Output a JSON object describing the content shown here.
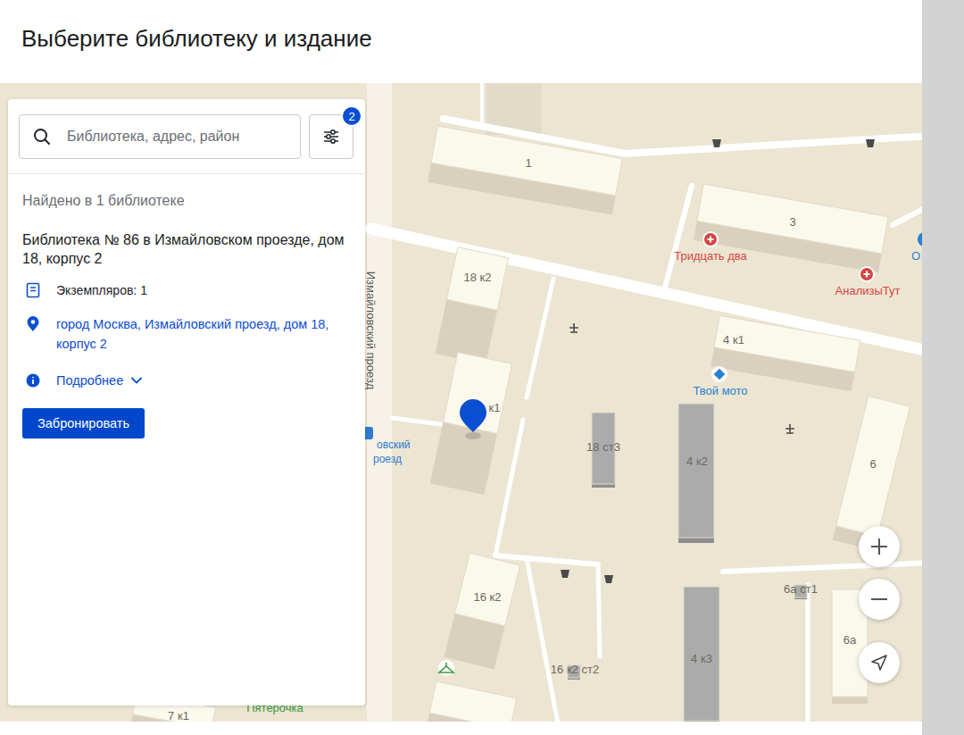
{
  "page": {
    "title": "Выберите библиотеку и издание"
  },
  "search": {
    "placeholder": "Библиотека, адрес, район"
  },
  "filters": {
    "badge": "2"
  },
  "results": {
    "summary": "Найдено в 1 библиотеке",
    "libraries": [
      {
        "name": "Библиотека № 86 в Измайловском проезде, дом 18, корпус 2",
        "copies": "Экземпляров: 1",
        "address": "город Москва, Измайловский проезд, дом 18, корпус 2",
        "details": "Подробнее",
        "expanded": false,
        "action": "Забронировать",
        "selected": true
      }
    ]
  },
  "map": {
    "street": "Измайловский проезд",
    "bus_stop": [
      "овский",
      "роезд"
    ],
    "buildings": [
      "1",
      "3",
      "18 к2",
      "к1",
      "4 к1",
      "18 ст3",
      "4 к2",
      "6",
      "16 к2",
      "16 к2 ст2",
      "4 к3",
      "6а ст1",
      "6а",
      "7 к1"
    ],
    "places": [
      {
        "name": "Тридцать два",
        "kind": "medical",
        "color": "#d64545"
      },
      {
        "name": "АнализыТут",
        "kind": "medical",
        "color": "#d64545"
      },
      {
        "name": "Твой мото",
        "kind": "moto",
        "color": "#2b7fd0"
      },
      {
        "name": "О",
        "kind": "place",
        "color": "#2b7fd0"
      },
      {
        "name": "Пятерочка",
        "kind": "shop",
        "color": "#3b9a3b"
      }
    ]
  }
}
